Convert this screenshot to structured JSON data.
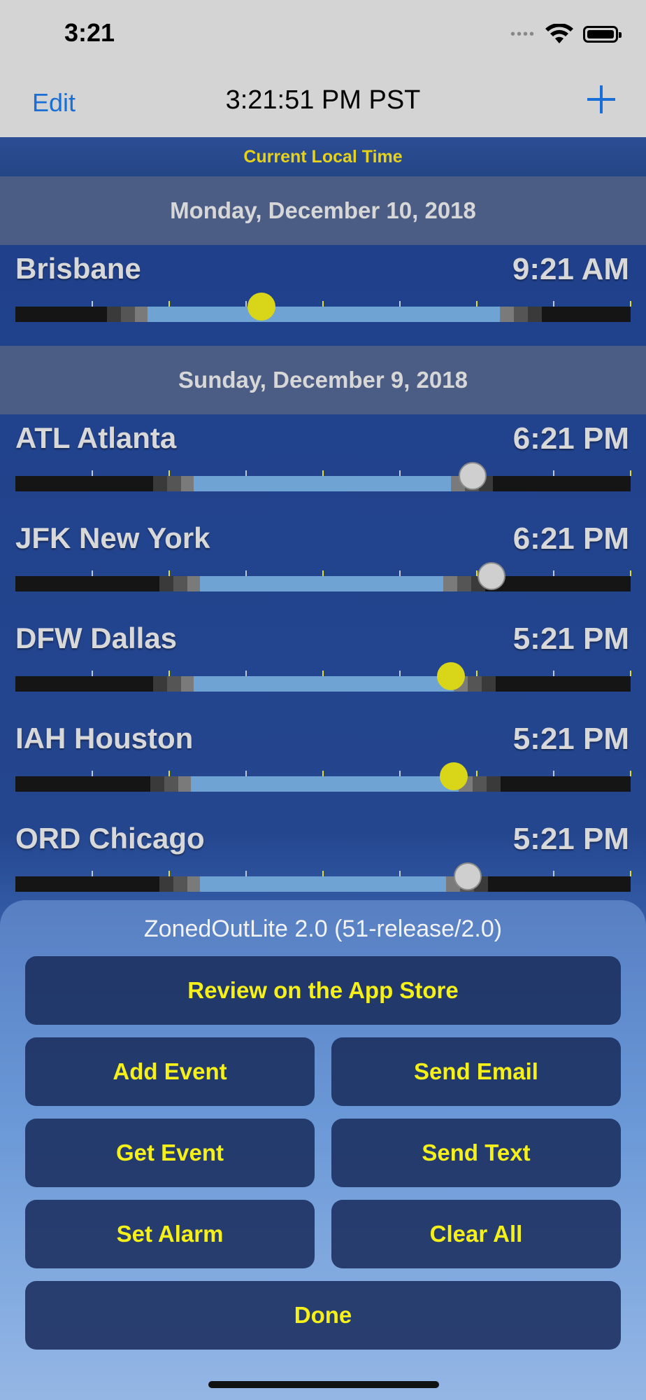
{
  "status_bar": {
    "time": "3:21",
    "signal_dots": "••••"
  },
  "nav": {
    "edit": "Edit",
    "title": "3:21:51 PM PST"
  },
  "local_time_label": "Current Local Time",
  "sections": [
    {
      "date": "Monday, December 10, 2018",
      "rows": [
        {
          "city": "Brisbane",
          "time": "9:21 AM",
          "day_start": 0.215,
          "day_end": 0.787,
          "marker": 0.4,
          "marker_type": "sun"
        }
      ]
    },
    {
      "date": "Sunday, December 9, 2018",
      "rows": [
        {
          "city": "ATL Atlanta",
          "time": "6:21 PM",
          "day_start": 0.29,
          "day_end": 0.708,
          "marker": 0.743,
          "marker_type": "moon"
        },
        {
          "city": "JFK New York",
          "time": "6:21 PM",
          "day_start": 0.3,
          "day_end": 0.695,
          "marker": 0.774,
          "marker_type": "moon"
        },
        {
          "city": "DFW Dallas",
          "time": "5:21 PM",
          "day_start": 0.29,
          "day_end": 0.713,
          "marker": 0.708,
          "marker_type": "sun"
        },
        {
          "city": "IAH Houston",
          "time": "5:21 PM",
          "day_start": 0.285,
          "day_end": 0.72,
          "marker": 0.713,
          "marker_type": "sun"
        },
        {
          "city": "ORD Chicago",
          "time": "5:21 PM",
          "day_start": 0.3,
          "day_end": 0.7,
          "marker": 0.735,
          "marker_type": "moon"
        }
      ]
    }
  ],
  "sheet": {
    "title": "ZonedOutLite 2.0 (51-release/2.0)",
    "review": "Review on the App Store",
    "add_event": "Add Event",
    "send_email": "Send Email",
    "get_event": "Get Event",
    "send_text": "Send Text",
    "set_alarm": "Set Alarm",
    "clear_all": "Clear All",
    "done": "Done"
  }
}
